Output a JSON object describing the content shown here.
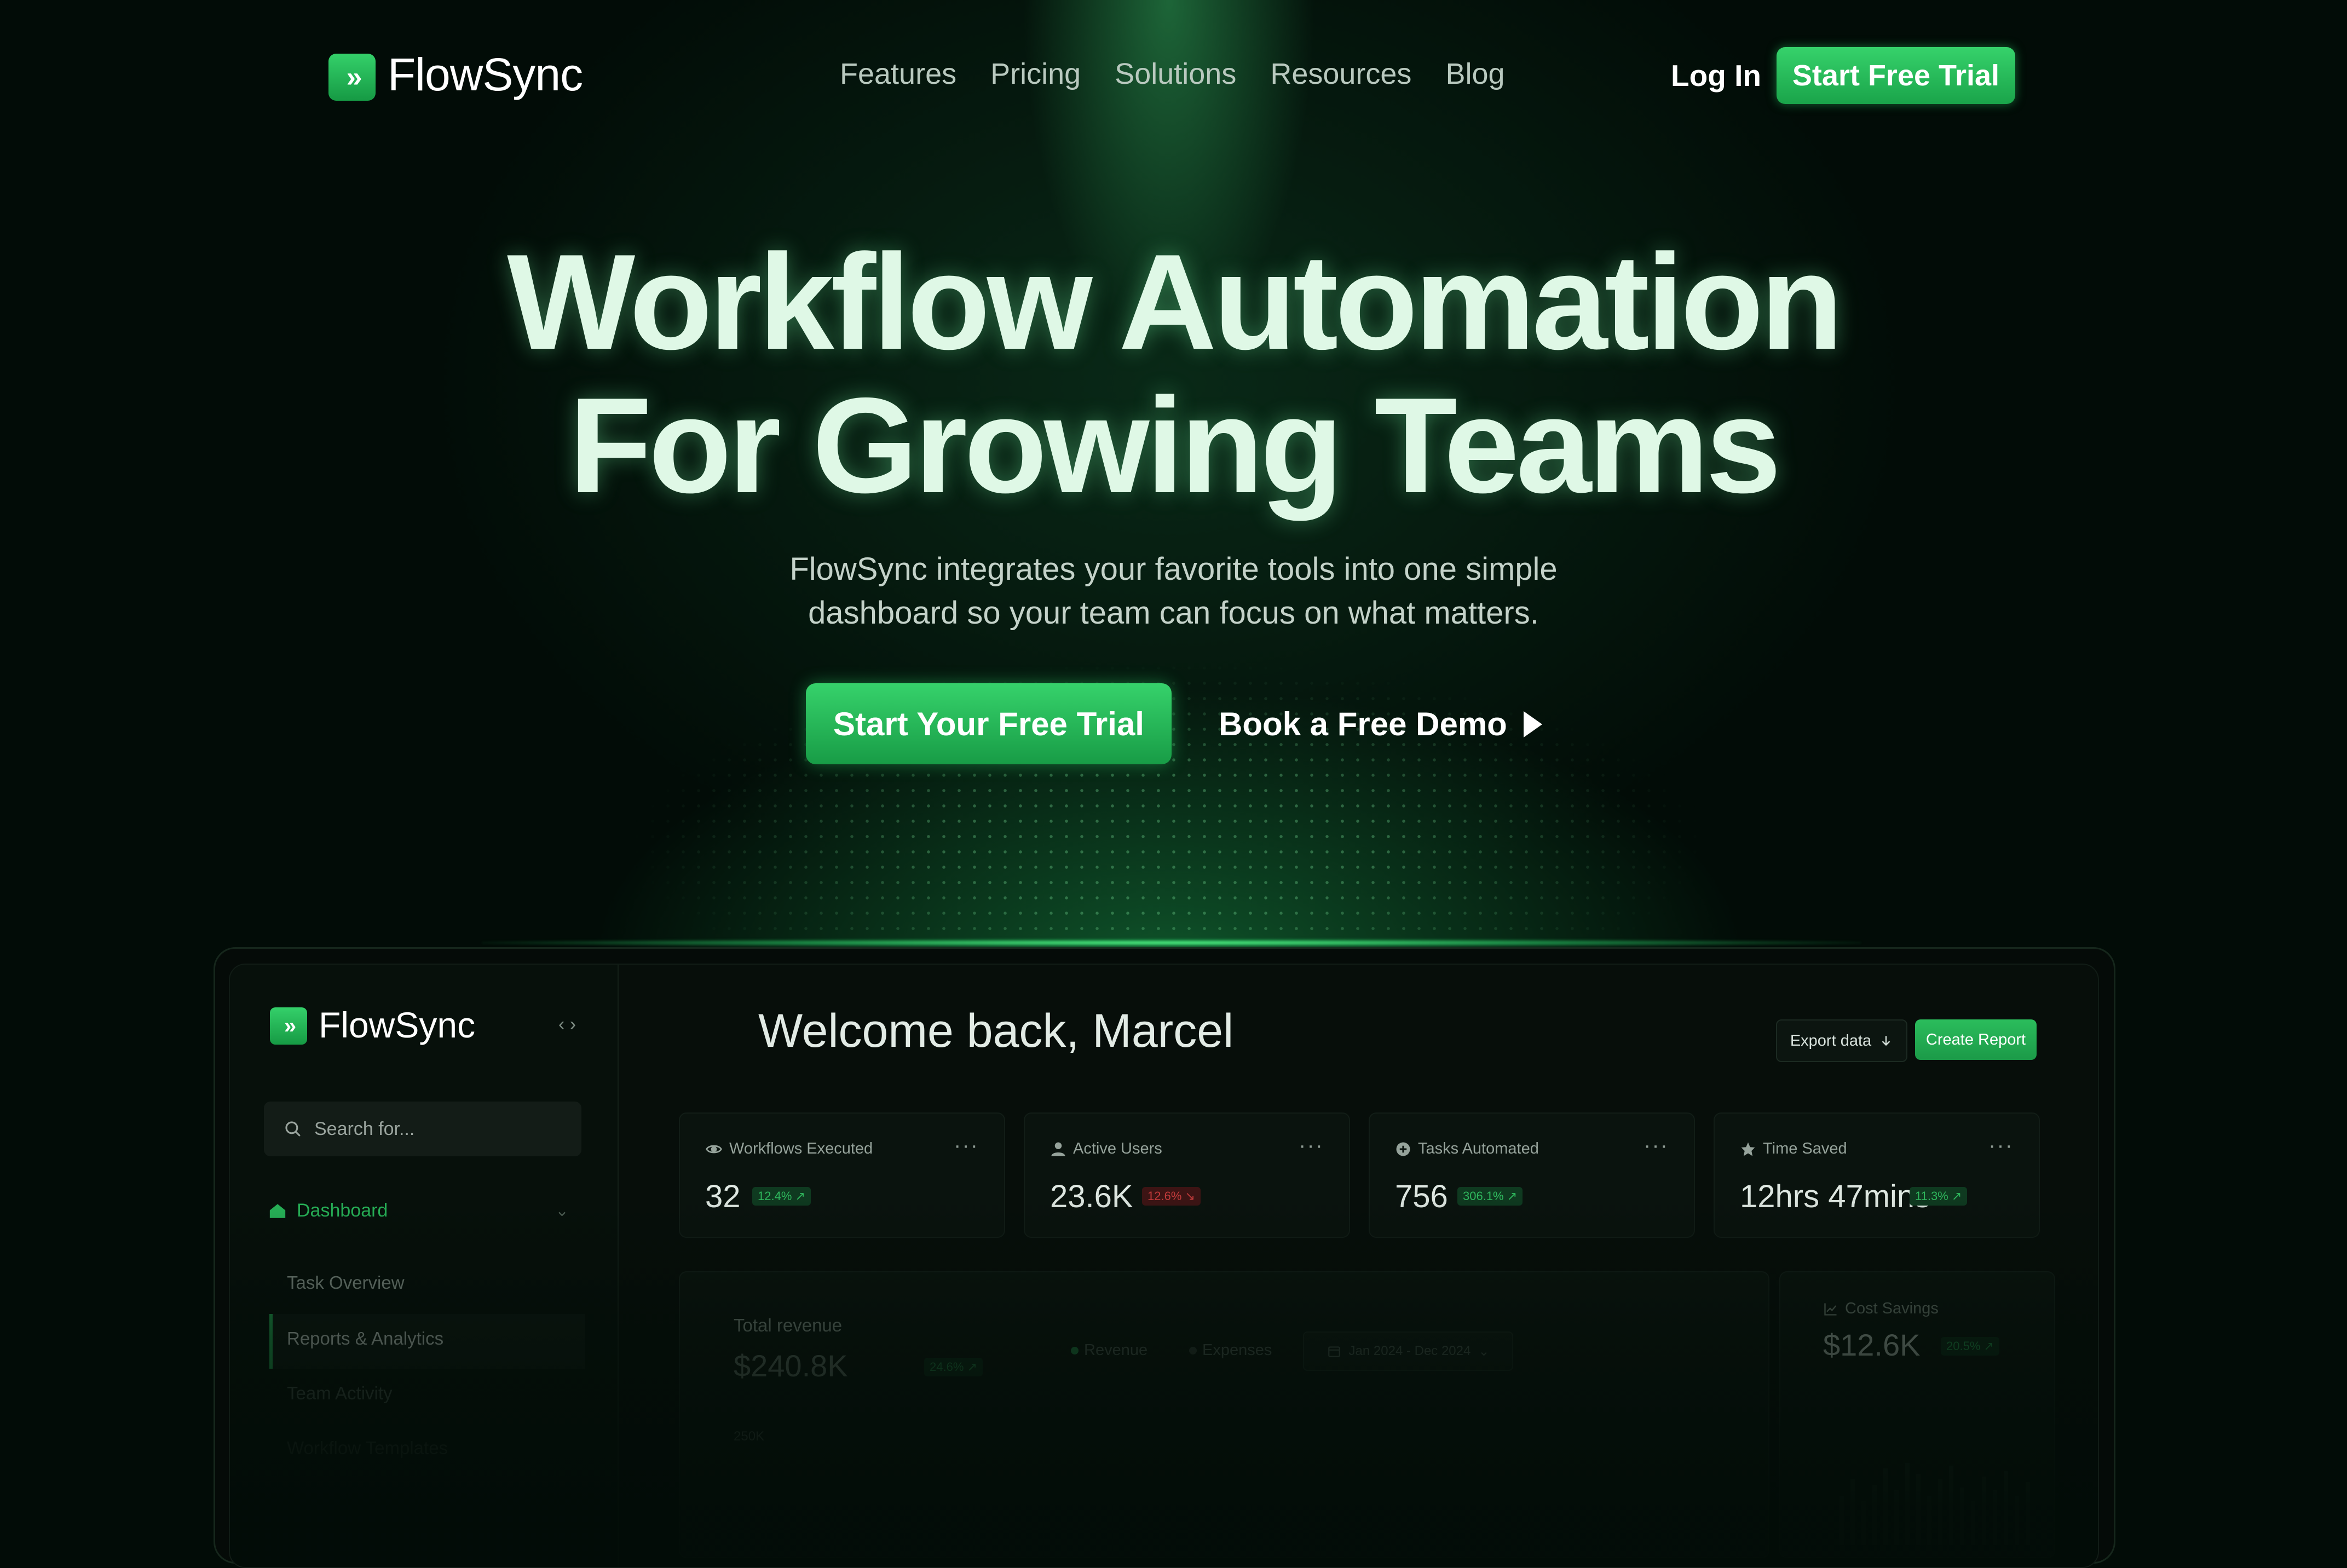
{
  "nav": {
    "brand": "FlowSync",
    "links": [
      "Features",
      "Pricing",
      "Solutions",
      "Resources",
      "Blog"
    ],
    "login": "Log In",
    "cta": "Start Free Trial"
  },
  "hero": {
    "title_line1": "Workflow Automation",
    "title_line2": "For Growing Teams",
    "subtitle_line1": "FlowSync integrates your favorite tools into one simple",
    "subtitle_line2": "dashboard so your team can focus on what matters.",
    "primary_cta": "Start Your Free Trial",
    "secondary_cta": "Book a Free Demo"
  },
  "dashboard": {
    "brand": "FlowSync",
    "collapse_glyph": "‹ ›",
    "search_placeholder": "Search for...",
    "nav_section": "Dashboard",
    "nav_items": [
      "Task Overview",
      "Reports & Analytics",
      "Team Activity",
      "Workflow Templates"
    ],
    "welcome": "Welcome back, Marcel",
    "export_label": "Export data",
    "create_label": "Create Report",
    "kpis": [
      {
        "label": "Workflows Executed",
        "value": "32",
        "change": "12.4% ↗",
        "trend": "up",
        "icon": "eye-icon"
      },
      {
        "label": "Active Users",
        "value": "23.6K",
        "change": "12.6% ↘",
        "trend": "down",
        "icon": "user-icon"
      },
      {
        "label": "Tasks Automated",
        "value": "756",
        "change": "306.1% ↗",
        "trend": "up",
        "icon": "plus-circle-icon"
      },
      {
        "label": "Time Saved",
        "value": "12hrs 47mins",
        "change": "11.3% ↗",
        "trend": "up",
        "icon": "star-icon"
      }
    ],
    "revenue": {
      "label": "Total revenue",
      "value": "$240.8K",
      "change": "24.6% ↗",
      "legend": [
        "Revenue",
        "Expenses"
      ],
      "date_range": "Jan 2024 - Dec 2024",
      "y_tick": "250K"
    },
    "cost_savings": {
      "label": "Cost Savings",
      "value": "$12.6K",
      "change": "20.5% ↗",
      "icon": "trend-chart-icon"
    }
  },
  "colors": {
    "accent": "#22b455",
    "background": "#020c07",
    "negative": "#c23b3b"
  }
}
